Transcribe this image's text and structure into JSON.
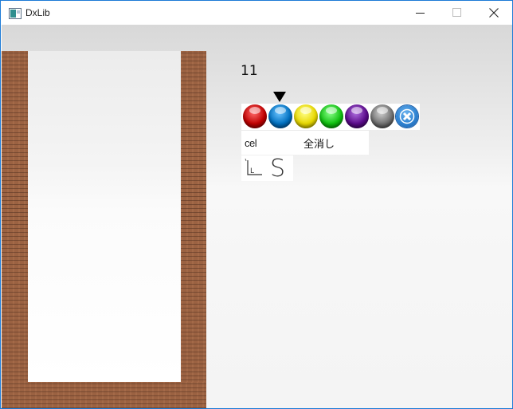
{
  "window": {
    "title": "DxLib"
  },
  "icons": {
    "app": "app-icon",
    "minimize": "minimize-icon",
    "maximize": "maximize-icon",
    "close": "close-icon",
    "selector": "triangle-down-icon",
    "palette_close": "close-circle-icon"
  },
  "game": {
    "score": "11",
    "palette": {
      "balls": [
        {
          "name": "red",
          "color": "#c00000"
        },
        {
          "name": "blue",
          "color": "#0070c0",
          "selected": true
        },
        {
          "name": "yellow",
          "color": "#e8d800"
        },
        {
          "name": "green",
          "color": "#10c010"
        },
        {
          "name": "purple",
          "color": "#5a0a8a"
        },
        {
          "name": "gray",
          "color": "#707070"
        }
      ]
    },
    "tools": {
      "cel_label": "cel",
      "clear_all_label": "全消し",
      "size_large_label": "L",
      "size_small_label": "S"
    }
  }
}
